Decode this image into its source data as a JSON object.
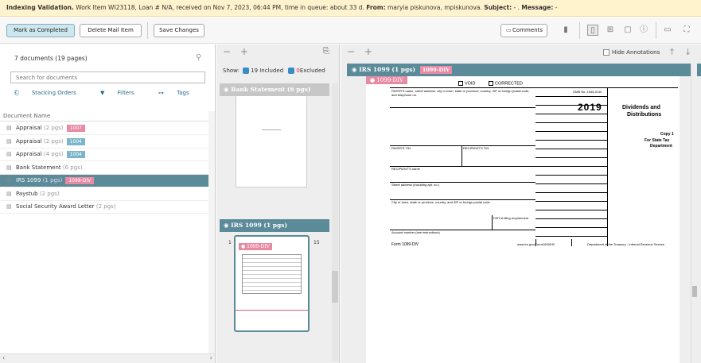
{
  "topbar": {
    "title": "Indexing Validation.",
    "info": " Work Item WI23118, Loan # N/A, received on Nov 7, 2023, 06:44 PM, time in queue: about 33 d. ",
    "from_label": "From:",
    "from_value": " maryia piskunova, mpiskunova. ",
    "subject_label": "Subject:",
    "subject_value": " - . ",
    "message_label": "Message:",
    "message_value": " -"
  },
  "toolbar": {
    "mark_completed": "Mark as Completed",
    "delete_mail": "Delete Mail Item",
    "save_changes": "Save Changes",
    "comments": "Comments"
  },
  "left": {
    "doc_count": "7 documents (19 pages)",
    "search_placeholder": "Search for documents",
    "stacking": "Stacking Orders",
    "filters": "Filters",
    "tags": "Tags",
    "col_header": "Document Name",
    "docs": [
      {
        "name": "Appraisal",
        "pages": "(2 pgs)",
        "badge": "1007",
        "badge_color": "#e88aa4"
      },
      {
        "name": "Appraisal",
        "pages": "(2 pgs)",
        "badge": "1004",
        "badge_color": "#7bb5c9"
      },
      {
        "name": "Appraisal",
        "pages": "(4 pgs)",
        "badge": "1004",
        "badge_color": "#7bb5c9"
      },
      {
        "name": "Bank Statement",
        "pages": "(6 pgs)",
        "badge": "",
        "badge_color": ""
      },
      {
        "name": "IRS 1099",
        "pages": "(1 pgs)",
        "badge": "1099-DIV",
        "badge_color": "#e88aa4"
      },
      {
        "name": "Paystub",
        "pages": "(2 pgs)",
        "badge": "",
        "badge_color": ""
      },
      {
        "name": "Social Security Award Letter",
        "pages": "(2 pgs)",
        "badge": "",
        "badge_color": ""
      }
    ]
  },
  "middle": {
    "show": "Show:",
    "included": "19 Included",
    "excluded_count": "0",
    "excluded": "Excluded",
    "group1": "Bank Statement (6 pgs)",
    "group2": "IRS 1099 (1 pgs)",
    "thumb_badge": "1099-DIV",
    "page_num": "1",
    "page_num_right": "15"
  },
  "right": {
    "hide_annotations": "Hide Annotations",
    "doc_header": "IRS 1099 (1 pgs)",
    "doc_badge": "1099-DIV",
    "page_badge": "1099-DIV",
    "form": {
      "void": "VOID",
      "corrected": "CORRECTED",
      "year": "2019",
      "title1": "Dividends and",
      "title2": "Distributions",
      "copy1": "Copy 1",
      "copy2": "For State Tax",
      "copy3": "Department",
      "form_name": "Form 1099-DIV",
      "omb": "OMB No. 1545-0110",
      "payer": "PAYER'S name, street address, city or town, state or province, country, ZIP or foreign postal code, and telephone no.",
      "payer_tin": "PAYER'S TIN",
      "recipient_tin": "RECIPIENT'S TIN",
      "recipient_name": "RECIPIENT'S name",
      "street": "Street address (including apt. no.)",
      "city": "City or town, state or province, country, and ZIP or foreign postal code",
      "fatca": "FATCA filing requirement",
      "account": "Account number (see instructions)",
      "footer_url": "www.irs.gov/Form1099DIV",
      "footer_dept": "Department of the Treasury - Internal Revenue Service"
    }
  },
  "colors": {
    "teal": "#5b8a99",
    "pink": "#e88aa4",
    "topbar_bg": "#fff3cd"
  }
}
